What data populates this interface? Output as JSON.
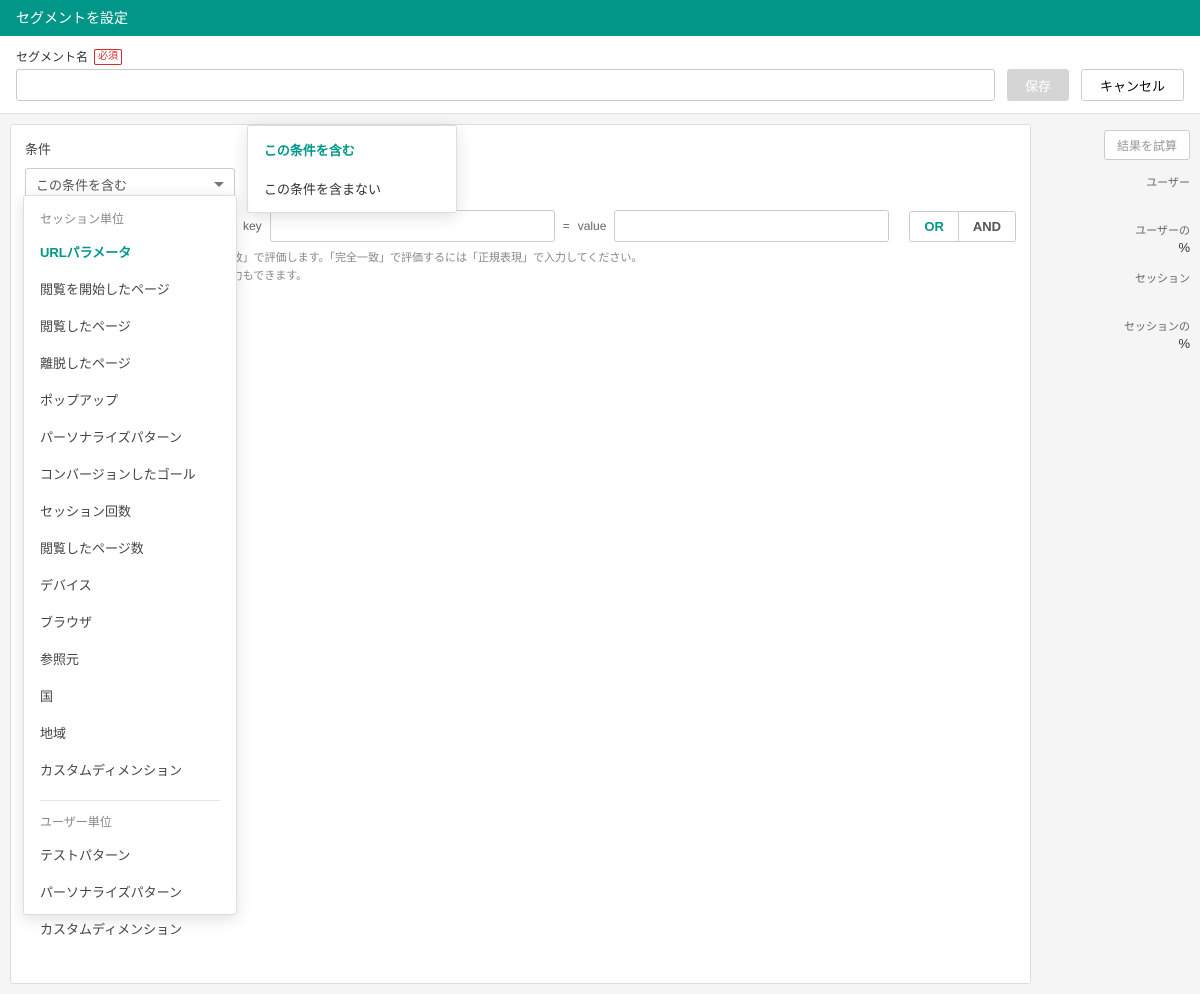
{
  "header": {
    "title": "セグメントを設定"
  },
  "toolbar": {
    "name_label": "セグメント名",
    "required_badge": "必須",
    "name_value": "",
    "save_label": "保存",
    "cancel_label": "キャンセル"
  },
  "panel": {
    "title": "条件",
    "condition_select": "この条件を含む",
    "type_select": "URLパラメータ",
    "key_label": "key",
    "key_value": "",
    "eq": "=",
    "value_label": "value",
    "value_value": "",
    "or_label": "OR",
    "and_label": "AND",
    "hint1": "※「key」と「value」はそれぞれ「部分一致」で評価します。「完全一致」で評価するには「正規表現」で入力してください。",
    "hint2": "※「key」のみ、または「value」のみの入力もできます。"
  },
  "condition_options": [
    {
      "label": "この条件を含む",
      "selected": true
    },
    {
      "label": "この条件を含まない",
      "selected": false
    }
  ],
  "type_groups": [
    {
      "title": "セッション単位",
      "options": [
        {
          "label": "URLパラメータ",
          "selected": true
        },
        {
          "label": "閲覧を開始したページ"
        },
        {
          "label": "閲覧したページ"
        },
        {
          "label": "離脱したページ"
        },
        {
          "label": "ポップアップ"
        },
        {
          "label": "パーソナライズパターン"
        },
        {
          "label": "コンバージョンしたゴール"
        },
        {
          "label": "セッション回数"
        },
        {
          "label": "閲覧したページ数"
        },
        {
          "label": "デバイス"
        },
        {
          "label": "ブラウザ"
        },
        {
          "label": "参照元"
        },
        {
          "label": "国"
        },
        {
          "label": "地域"
        },
        {
          "label": "カスタムディメンション"
        }
      ]
    },
    {
      "title": "ユーザー単位",
      "options": [
        {
          "label": "テストパターン"
        },
        {
          "label": "パーソナライズパターン"
        },
        {
          "label": "カスタムディメンション"
        }
      ]
    }
  ],
  "side": {
    "calc_label": "結果を試算",
    "metrics": [
      {
        "label": "ユーザー",
        "value": ""
      },
      {
        "label": "ユーザーの",
        "value": "%"
      },
      {
        "label": "セッション",
        "value": ""
      },
      {
        "label": "セッションの",
        "value": "%"
      }
    ]
  }
}
